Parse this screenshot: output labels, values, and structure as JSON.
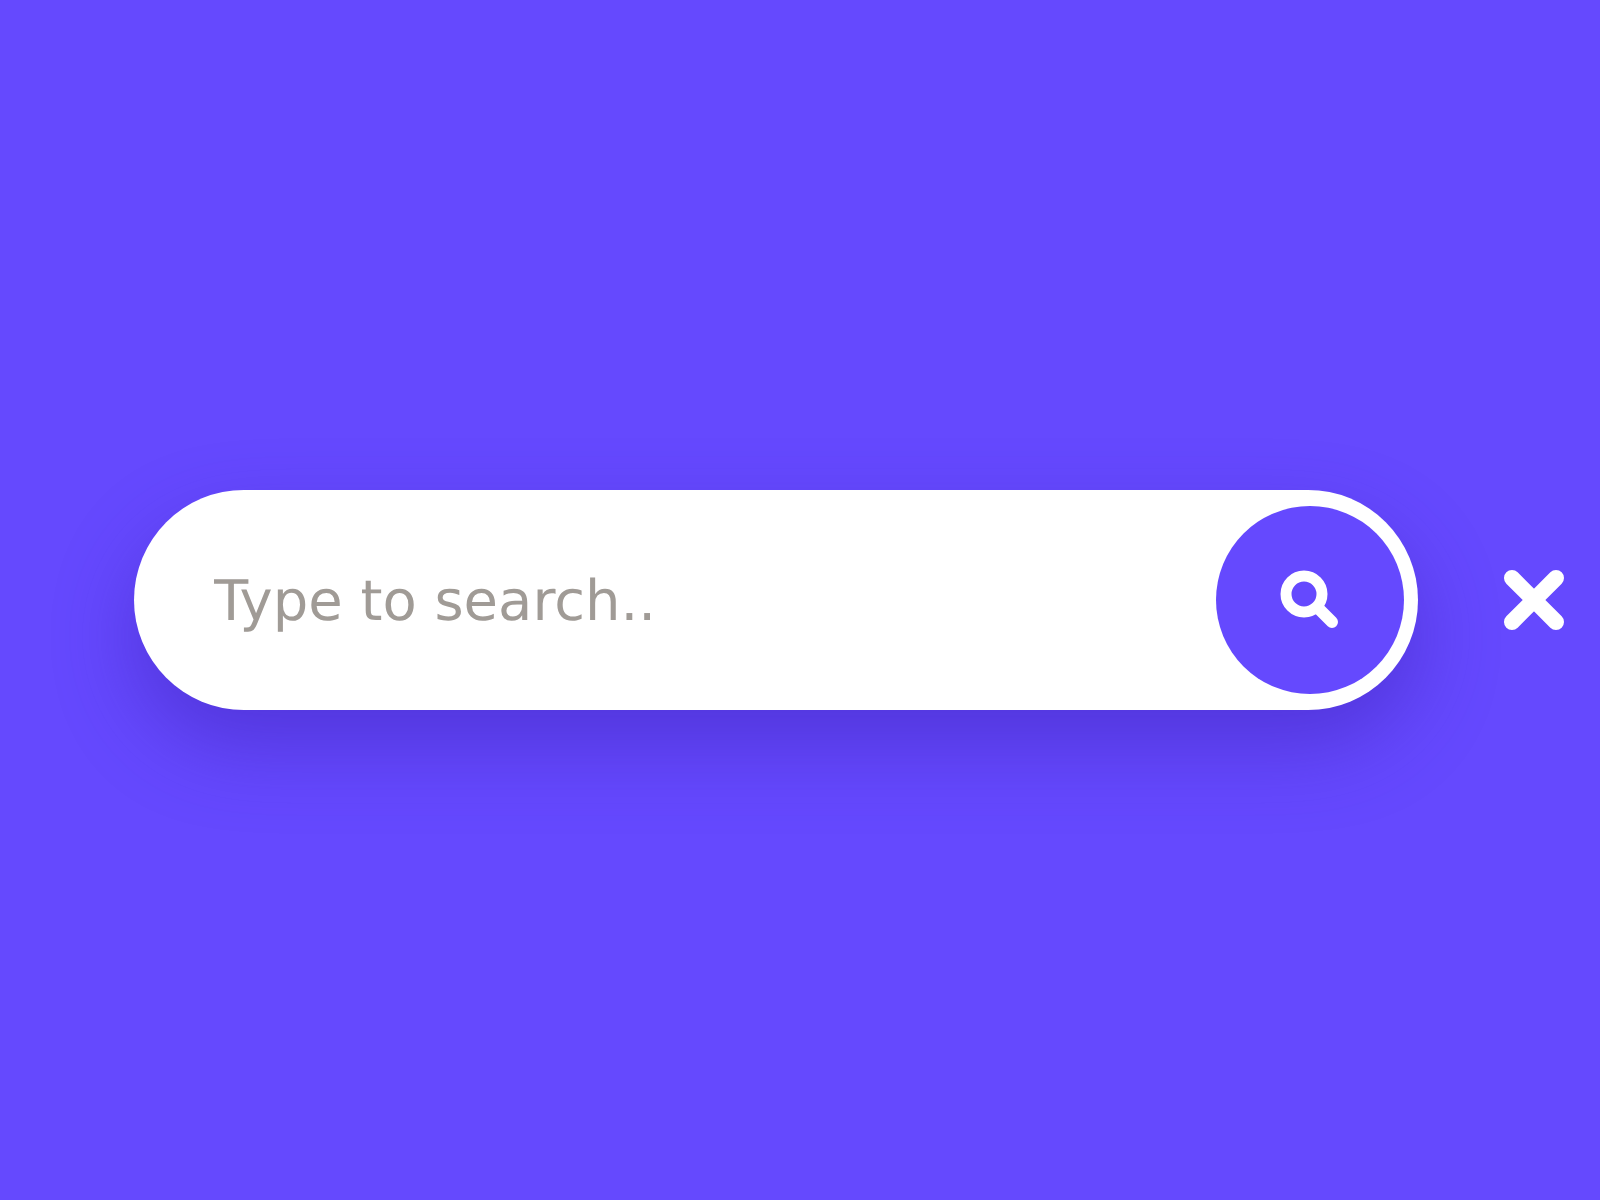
{
  "search": {
    "placeholder": "Type to search.."
  }
}
